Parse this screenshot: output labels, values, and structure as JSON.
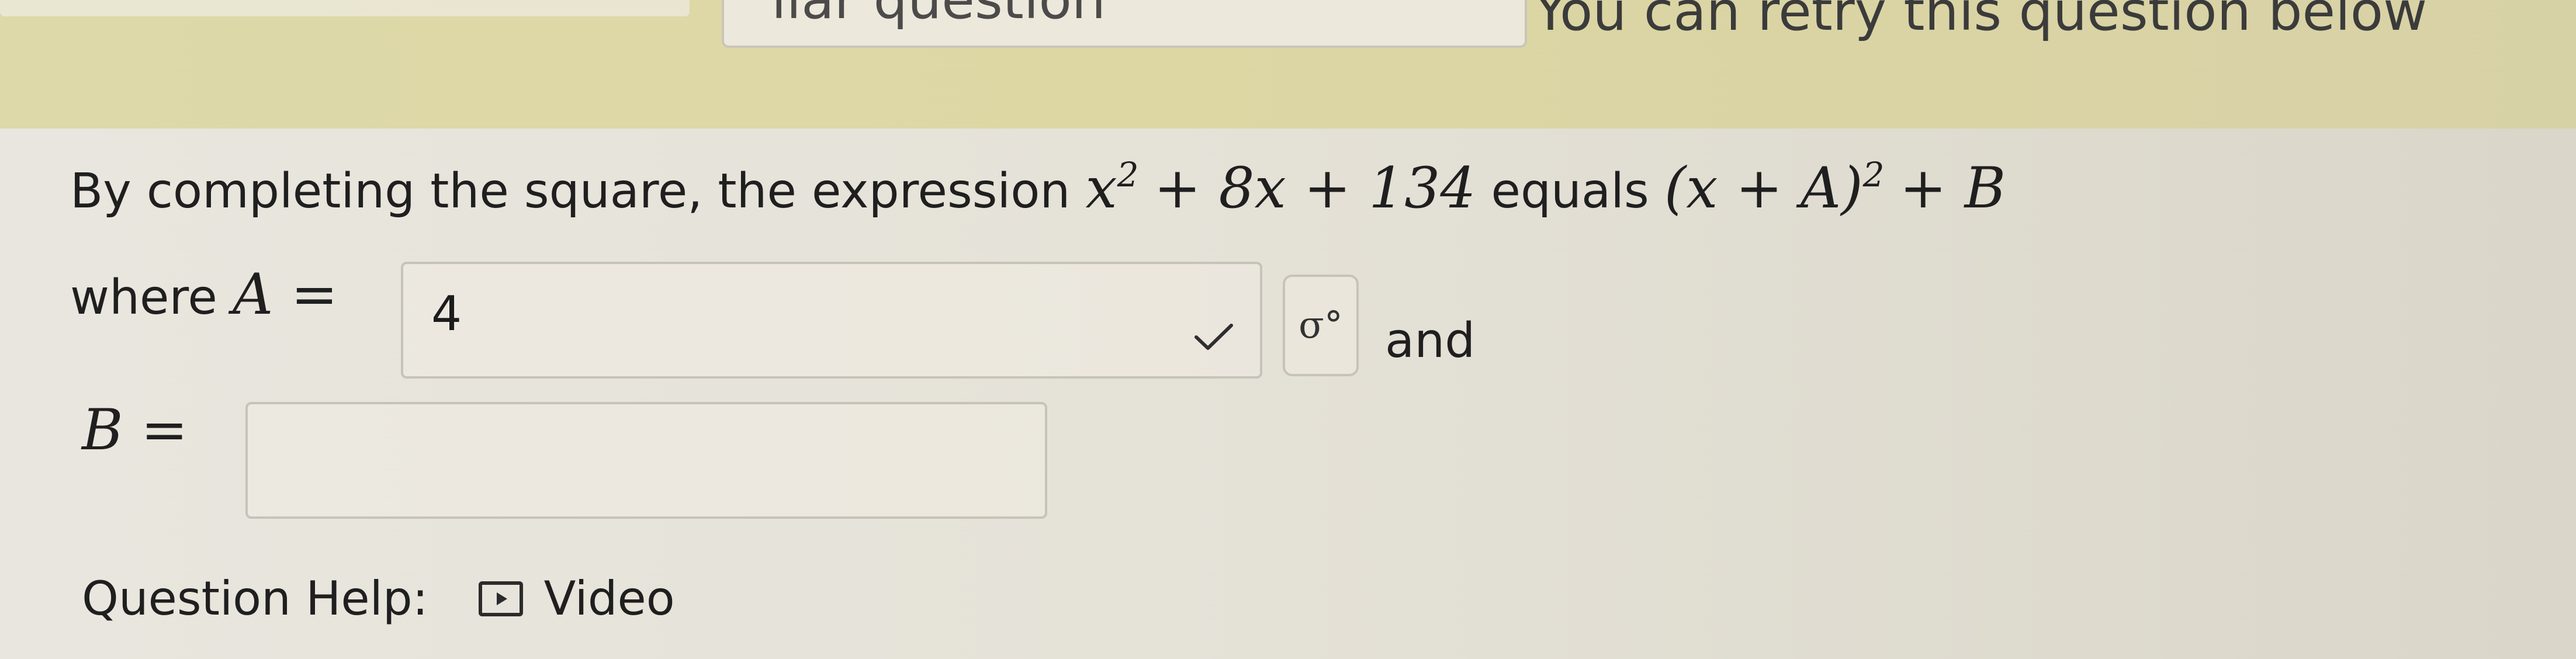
{
  "banner": {
    "middle_text": "ilar question",
    "right_text": "You can retry this question below"
  },
  "question": {
    "text": "By completing the square, the expression",
    "expression_x": "x",
    "expression_power": "2",
    "expression_tail": "+ 8x + 134",
    "equals": "equals",
    "form_open": "(x + A)",
    "form_power": "2",
    "form_tail": "+ B"
  },
  "where": {
    "label": "where",
    "a_symbol": "A =",
    "a_value": "4",
    "and": "and"
  },
  "b_row": {
    "label": "B ="
  },
  "help": {
    "label": "Question Help:",
    "video_label": "Video"
  }
}
